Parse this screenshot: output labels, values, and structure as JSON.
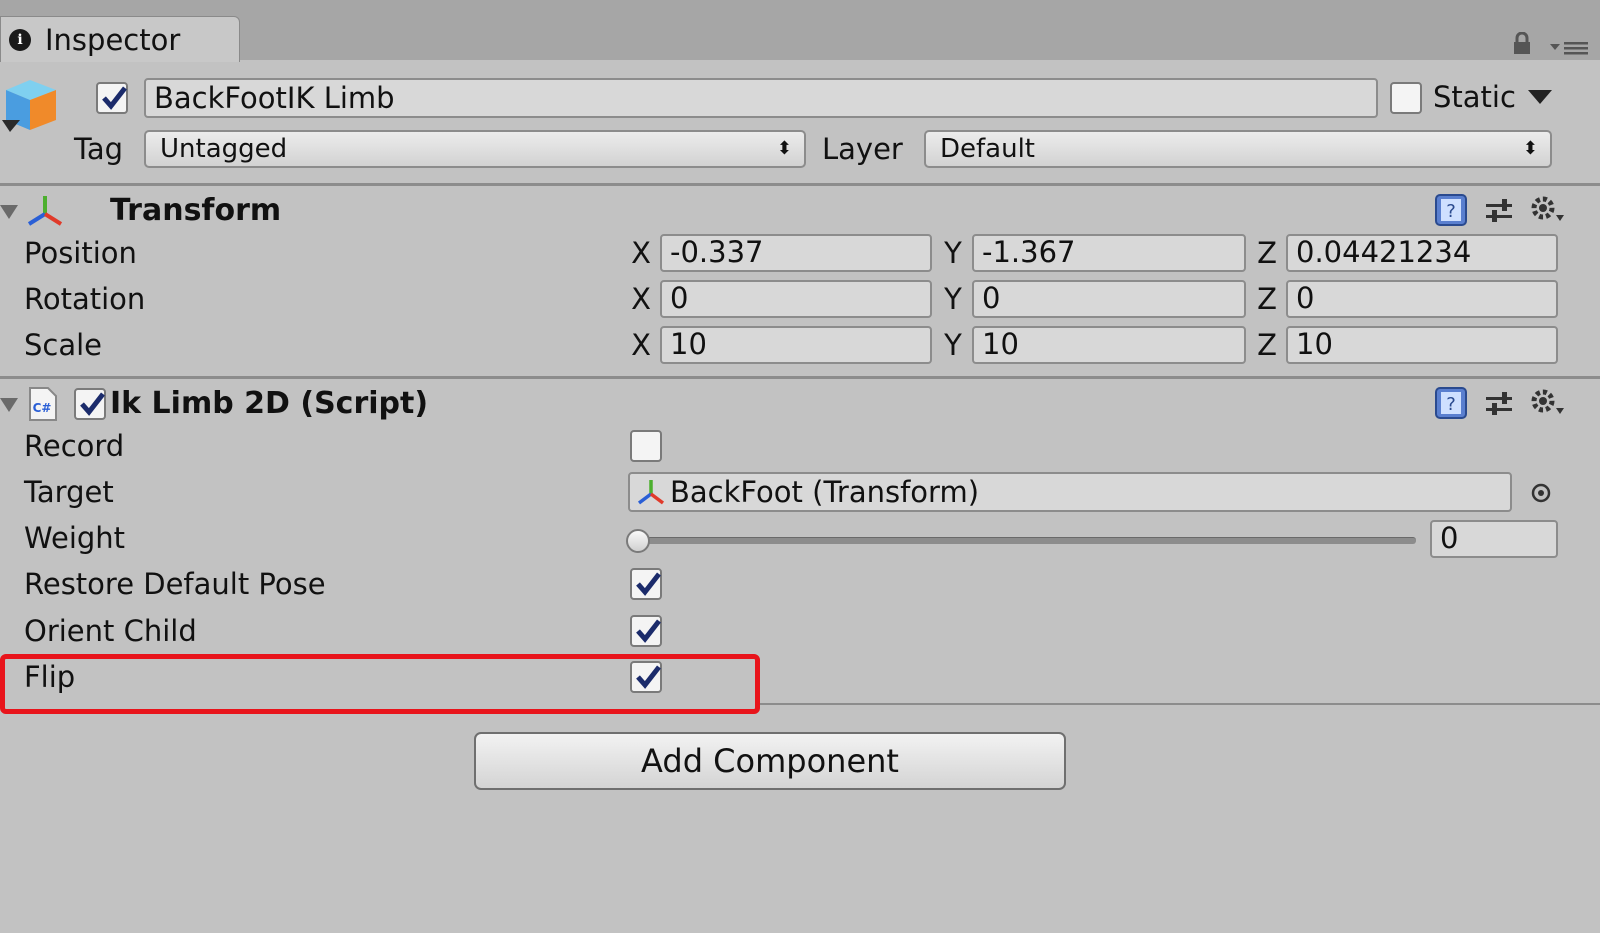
{
  "tab": {
    "title": "Inspector",
    "info_icon": "i"
  },
  "header": {
    "object_name": "BackFootIK Limb",
    "active": true,
    "static_label": "Static",
    "static_checked": false,
    "tag_label": "Tag",
    "tag_value": "Untagged",
    "layer_label": "Layer",
    "layer_value": "Default"
  },
  "transform": {
    "title": "Transform",
    "rows": [
      {
        "label": "Position",
        "x": "-0.337",
        "y": "-1.367",
        "z": "0.04421234"
      },
      {
        "label": "Rotation",
        "x": "0",
        "y": "0",
        "z": "0"
      },
      {
        "label": "Scale",
        "x": "10",
        "y": "10",
        "z": "10"
      }
    ],
    "axis_x": "X",
    "axis_y": "Y",
    "axis_z": "Z"
  },
  "ik": {
    "title": "Ik Limb 2D (Script)",
    "enabled": true,
    "record_label": "Record",
    "record_checked": false,
    "target_label": "Target",
    "target_value": "BackFoot (Transform)",
    "weight_label": "Weight",
    "weight_value": "0",
    "weight_fraction": 0,
    "restore_label": "Restore Default Pose",
    "restore_checked": true,
    "orient_label": "Orient Child",
    "orient_checked": true,
    "flip_label": "Flip",
    "flip_checked": true
  },
  "add_component_label": "Add Component",
  "colors": {
    "highlight": "#e8141b",
    "check": "#1b2b6b"
  }
}
